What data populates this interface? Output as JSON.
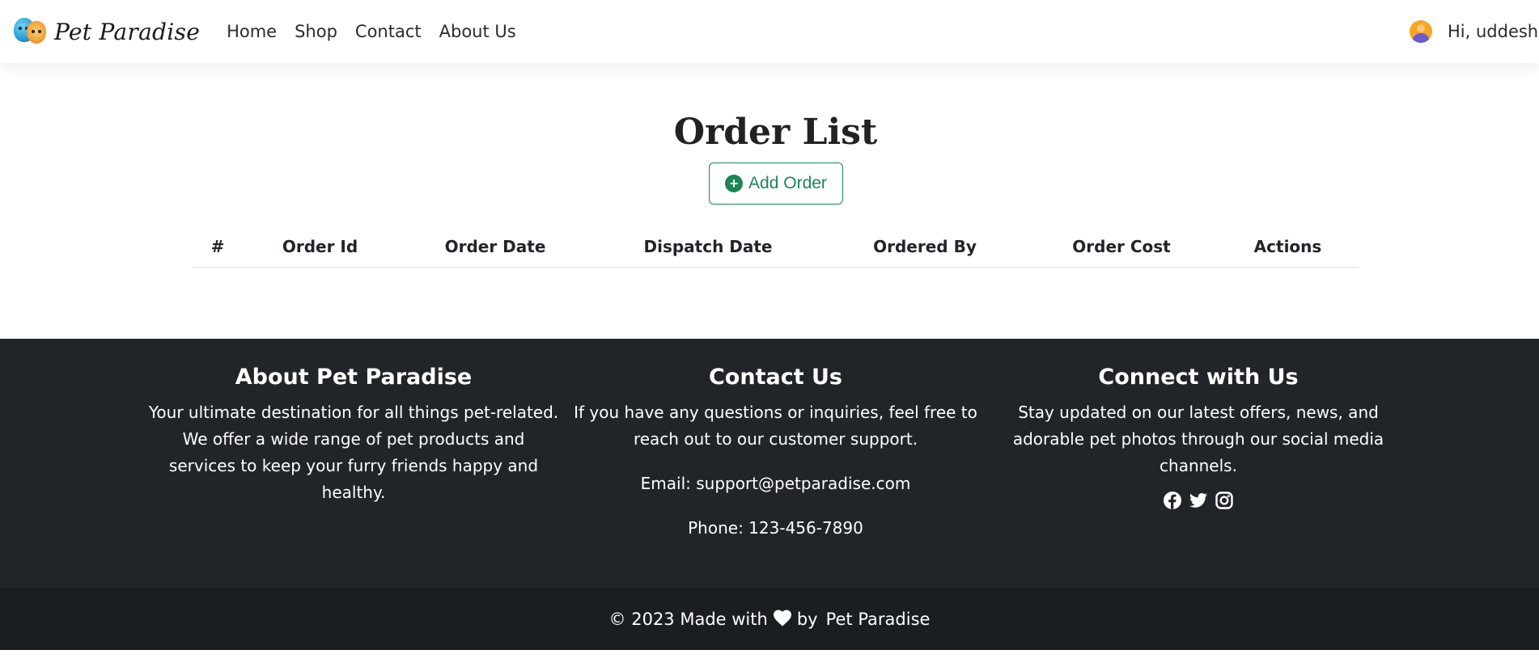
{
  "navbar": {
    "brand": "Pet Paradise",
    "links": [
      "Home",
      "Shop",
      "Contact",
      "About Us"
    ],
    "greeting": "Hi, uddesh"
  },
  "main": {
    "title": "Order List",
    "add_button": "Add Order",
    "table": {
      "columns": [
        "#",
        "Order Id",
        "Order Date",
        "Dispatch Date",
        "Ordered By",
        "Order Cost",
        "Actions"
      ],
      "rows": []
    }
  },
  "footer": {
    "about": {
      "title": "About Pet Paradise",
      "text": "Your ultimate destination for all things pet-related. We offer a wide range of pet products and services to keep your furry friends happy and healthy."
    },
    "contact": {
      "title": "Contact Us",
      "text": "If you have any questions or inquiries, feel free to reach out to our customer support.",
      "email": "Email: support@petparadise.com",
      "phone": "Phone: 123-456-7890"
    },
    "connect": {
      "title": "Connect with Us",
      "text": "Stay updated on our latest offers, news, and adorable pet photos through our social media channels.",
      "icons": [
        "facebook-icon",
        "twitter-icon",
        "instagram-icon"
      ]
    },
    "copyright": {
      "prefix": "© 2023 Made with",
      "by": "by",
      "brand": "Pet Paradise"
    }
  },
  "colors": {
    "accent": "#198754",
    "footer": "#212529",
    "footer_bottom": "#1b1e21"
  }
}
